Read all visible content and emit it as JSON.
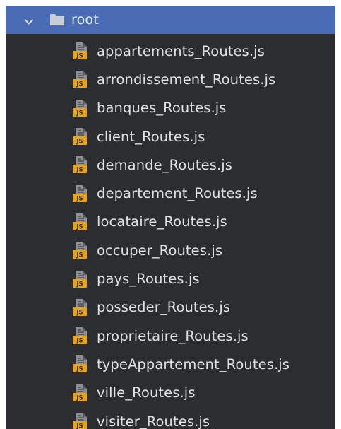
{
  "root": {
    "label": "root",
    "expanded": true,
    "chevron_icon": "chevron-down-icon",
    "folder_icon": "folder-icon"
  },
  "files": [
    {
      "name": "appartements_Routes.js",
      "icon": "js-file-icon"
    },
    {
      "name": "arrondissement_Routes.js",
      "icon": "js-file-icon"
    },
    {
      "name": "banques_Routes.js",
      "icon": "js-file-icon"
    },
    {
      "name": "client_Routes.js",
      "icon": "js-file-icon"
    },
    {
      "name": "demande_Routes.js",
      "icon": "js-file-icon"
    },
    {
      "name": "departement_Routes.js",
      "icon": "js-file-icon"
    },
    {
      "name": "locataire_Routes.js",
      "icon": "js-file-icon"
    },
    {
      "name": "occuper_Routes.js",
      "icon": "js-file-icon"
    },
    {
      "name": "pays_Routes.js",
      "icon": "js-file-icon"
    },
    {
      "name": "posseder_Routes.js",
      "icon": "js-file-icon"
    },
    {
      "name": "proprietaire_Routes.js",
      "icon": "js-file-icon"
    },
    {
      "name": "typeAppartement_Routes.js",
      "icon": "js-file-icon"
    },
    {
      "name": "ville_Routes.js",
      "icon": "js-file-icon"
    },
    {
      "name": "visiter_Routes.js",
      "icon": "js-file-icon"
    }
  ],
  "colors": {
    "panel_background": "#2b2d30",
    "selected_row": "#4a6cb4",
    "text": "#dfe1e5",
    "js_badge": "#e8a317"
  }
}
